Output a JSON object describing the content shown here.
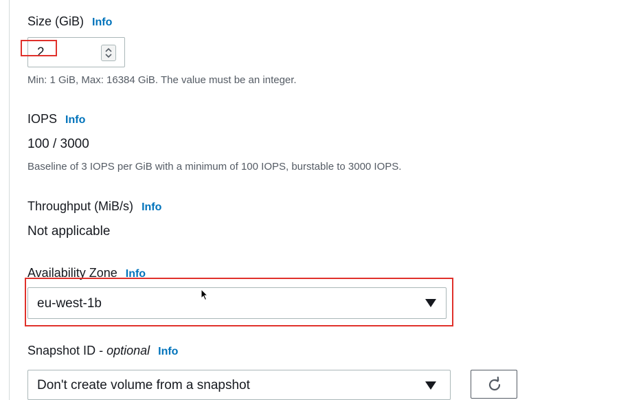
{
  "size": {
    "label": "Size (GiB)",
    "info": "Info",
    "value": "2",
    "help": "Min: 1 GiB, Max: 16384 GiB. The value must be an integer."
  },
  "iops": {
    "label": "IOPS",
    "info": "Info",
    "value": "100 / 3000",
    "help": "Baseline of 3 IOPS per GiB with a minimum of 100 IOPS, burstable to 3000 IOPS."
  },
  "throughput": {
    "label": "Throughput (MiB/s)",
    "info": "Info",
    "value": "Not applicable"
  },
  "availability_zone": {
    "label": "Availability Zone",
    "info": "Info",
    "selected": "eu-west-1b"
  },
  "snapshot": {
    "label": "Snapshot ID - ",
    "optional": "optional",
    "info": "Info",
    "selected": "Don't create volume from a snapshot"
  },
  "icons": {
    "stepper": "up-down-chevron-icon",
    "select": "caret-down-icon",
    "refresh": "refresh-icon",
    "cursor": "mouse-pointer-icon"
  },
  "colors": {
    "info_link": "#0073bb",
    "highlight": "#e0302a",
    "text": "#16191f",
    "help_text": "#545b64"
  }
}
